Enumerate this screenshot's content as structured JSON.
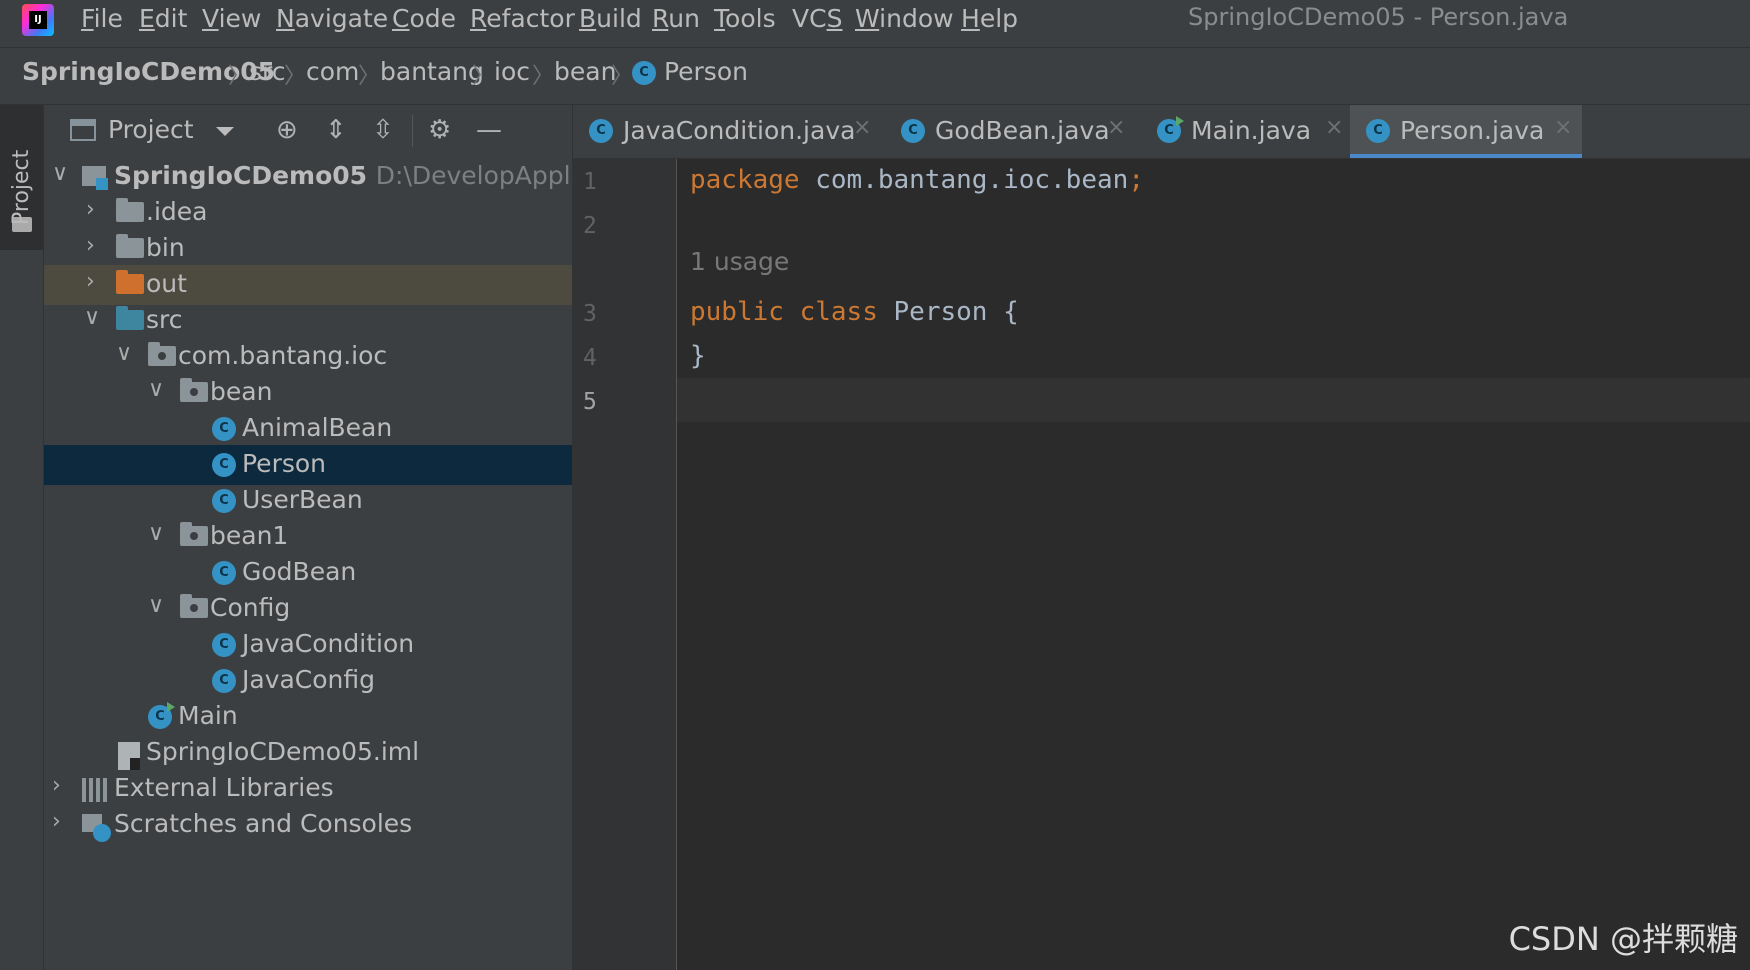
{
  "menubar": {
    "items": [
      {
        "label": "File",
        "mnemonic": "F",
        "rest": "ile"
      },
      {
        "label": "Edit",
        "mnemonic": "E",
        "rest": "dit"
      },
      {
        "label": "View",
        "mnemonic": "V",
        "rest": "iew"
      },
      {
        "label": "Navigate",
        "mnemonic": "N",
        "rest": "avigate"
      },
      {
        "label": "Code",
        "mnemonic": "C",
        "rest": "ode"
      },
      {
        "label": "Refactor",
        "mnemonic": "R",
        "rest": "efactor"
      },
      {
        "label": "Build",
        "mnemonic": "B",
        "rest": "uild"
      },
      {
        "label": "Run",
        "mnemonic": "R",
        "rest": "un"
      },
      {
        "label": "Tools",
        "mnemonic": "T",
        "rest": "ools"
      },
      {
        "label": "VCS",
        "mnemonic": "S",
        "rest": ""
      },
      {
        "label": "Window",
        "mnemonic": "W",
        "rest": "indow"
      },
      {
        "label": "Help",
        "mnemonic": "H",
        "rest": "elp"
      }
    ],
    "window_title": "SpringIoCDemo05 - Person.java",
    "logo_text": "IJ"
  },
  "breadcrumb": {
    "items": [
      "SpringIoCDemo05",
      "src",
      "com",
      "bantang",
      "ioc",
      "bean",
      "Person"
    ],
    "class_icon_letter": "C"
  },
  "tool_strip": {
    "project_tab": "Project"
  },
  "project_panel": {
    "title": "Project",
    "tools": [
      "crosshair-icon",
      "expand-all-icon",
      "collapse-all-icon",
      "gear-icon",
      "minimize-icon"
    ],
    "tree": [
      {
        "label": "SpringIoCDemo05",
        "path": "D:\\DevelopApplica",
        "chevron": "∨",
        "icon": "module"
      },
      {
        "label": ".idea",
        "chevron": "›",
        "icon": "folder"
      },
      {
        "label": "bin",
        "chevron": "›",
        "icon": "folder"
      },
      {
        "label": "out",
        "chevron": "›",
        "icon": "folder-orange"
      },
      {
        "label": "src",
        "chevron": "∨",
        "icon": "folder-blue"
      },
      {
        "label": "com.bantang.ioc",
        "chevron": "∨",
        "icon": "package"
      },
      {
        "label": "bean",
        "chevron": "∨",
        "icon": "package"
      },
      {
        "label": "AnimalBean",
        "chevron": "",
        "icon": "class"
      },
      {
        "label": "Person",
        "chevron": "",
        "icon": "class"
      },
      {
        "label": "UserBean",
        "chevron": "",
        "icon": "class"
      },
      {
        "label": "bean1",
        "chevron": "∨",
        "icon": "package"
      },
      {
        "label": "GodBean",
        "chevron": "",
        "icon": "class"
      },
      {
        "label": "Config",
        "chevron": "∨",
        "icon": "package"
      },
      {
        "label": "JavaCondition",
        "chevron": "",
        "icon": "class"
      },
      {
        "label": "JavaConfig",
        "chevron": "",
        "icon": "class"
      },
      {
        "label": "Main",
        "chevron": "",
        "icon": "class-run"
      },
      {
        "label": "SpringIoCDemo05.iml",
        "chevron": "",
        "icon": "iml"
      },
      {
        "label": "External Libraries",
        "chevron": "›",
        "icon": "libraries"
      },
      {
        "label": "Scratches and Consoles",
        "chevron": "›",
        "icon": "scratches"
      }
    ]
  },
  "editor_tabs": [
    {
      "label": "JavaCondition.java",
      "close": "×",
      "active": false
    },
    {
      "label": "GodBean.java",
      "close": "×",
      "active": false
    },
    {
      "label": "Main.java",
      "close": "×",
      "active": false
    },
    {
      "label": "Person.java",
      "close": "×",
      "active": true
    }
  ],
  "editor": {
    "line_numbers": [
      "1",
      "2",
      "3",
      "4",
      "5"
    ],
    "code": {
      "line1_kw": "package",
      "line1_rest": " com.bantang.ioc.bean",
      "line1_semi": ";",
      "usage_hint": "1 usage",
      "line3_kw1": "public",
      "line3_kw2": "class",
      "line3_rest": " Person {",
      "line4": "}"
    }
  },
  "watermark": "CSDN @拌颗糖",
  "colors": {
    "keyword": "#cc7832",
    "class_icon": "#3592c4",
    "selection": "#0d293e",
    "active_tab_underline": "#4a88c7"
  }
}
